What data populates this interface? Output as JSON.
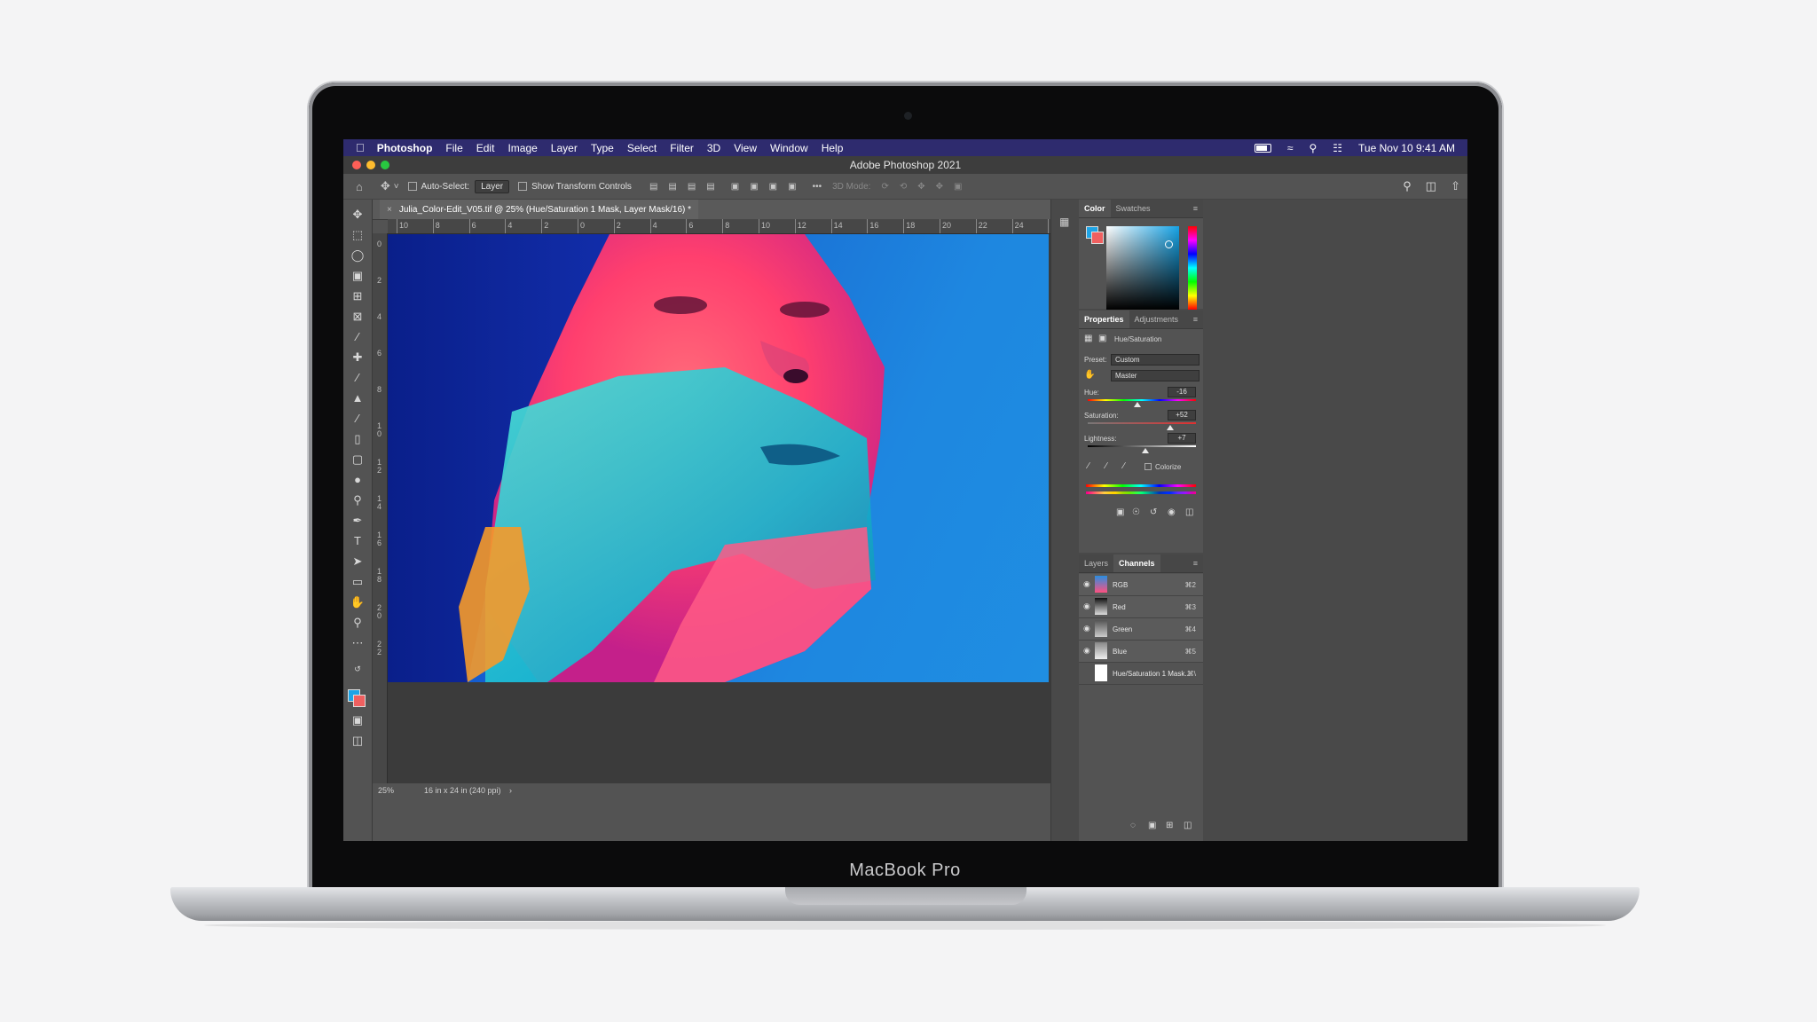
{
  "device": {
    "brand_label": "MacBook Pro"
  },
  "menubar": {
    "app_name": "Photoshop",
    "items": [
      "File",
      "Edit",
      "Image",
      "Layer",
      "Type",
      "Select",
      "Filter",
      "3D",
      "View",
      "Window",
      "Help"
    ],
    "clock": "Tue Nov 10  9:41 AM"
  },
  "window": {
    "title": "Adobe Photoshop 2021"
  },
  "options_bar": {
    "auto_select_label": "Auto-Select:",
    "auto_select_value": "Layer",
    "transform_label": "Show Transform Controls",
    "mode_3d_label": "3D Mode:",
    "more_label": "•••"
  },
  "document": {
    "tab_title": "Julia_Color-Edit_V05.tif @ 25% (Hue/Saturation 1 Mask, Layer Mask/16) *",
    "close_glyph": "×",
    "zoom": "25%",
    "size_info": "16 in x 24 in (240 ppi)",
    "status_arrow": "›"
  },
  "rulers": {
    "top_labels": [
      "10",
      "8",
      "6",
      "4",
      "2",
      "0",
      "2",
      "4",
      "6",
      "8",
      "10",
      "12",
      "14",
      "16",
      "18",
      "20",
      "22",
      "24",
      "2("
    ],
    "left_labels": [
      "0",
      "2",
      "4",
      "6",
      "8",
      "1\n0",
      "1\n2",
      "1\n4",
      "1\n6",
      "1\n8",
      "2\n0",
      "2\n2"
    ]
  },
  "color_panel": {
    "tabs": [
      "Color",
      "Swatches"
    ],
    "fg_color": "#1ea4e6",
    "bg_color": "#f06060"
  },
  "properties_panel": {
    "tabs": [
      "Properties",
      "Adjustments"
    ],
    "adjustment_name": "Hue/Saturation",
    "preset_label": "Preset:",
    "preset_value": "Custom",
    "channel_value": "Master",
    "hue_label": "Hue:",
    "hue_value": "-16",
    "saturation_label": "Saturation:",
    "saturation_value": "+52",
    "lightness_label": "Lightness:",
    "lightness_value": "+7",
    "colorize_label": "Colorize"
  },
  "channels_panel": {
    "tabs": [
      "Layers",
      "Channels"
    ],
    "rows": [
      {
        "name": "RGB",
        "shortcut": "⌘2"
      },
      {
        "name": "Red",
        "shortcut": "⌘3"
      },
      {
        "name": "Green",
        "shortcut": "⌘4"
      },
      {
        "name": "Blue",
        "shortcut": "⌘5"
      },
      {
        "name": "Hue/Saturation 1 Mask...",
        "shortcut": "⌘\\"
      }
    ]
  }
}
